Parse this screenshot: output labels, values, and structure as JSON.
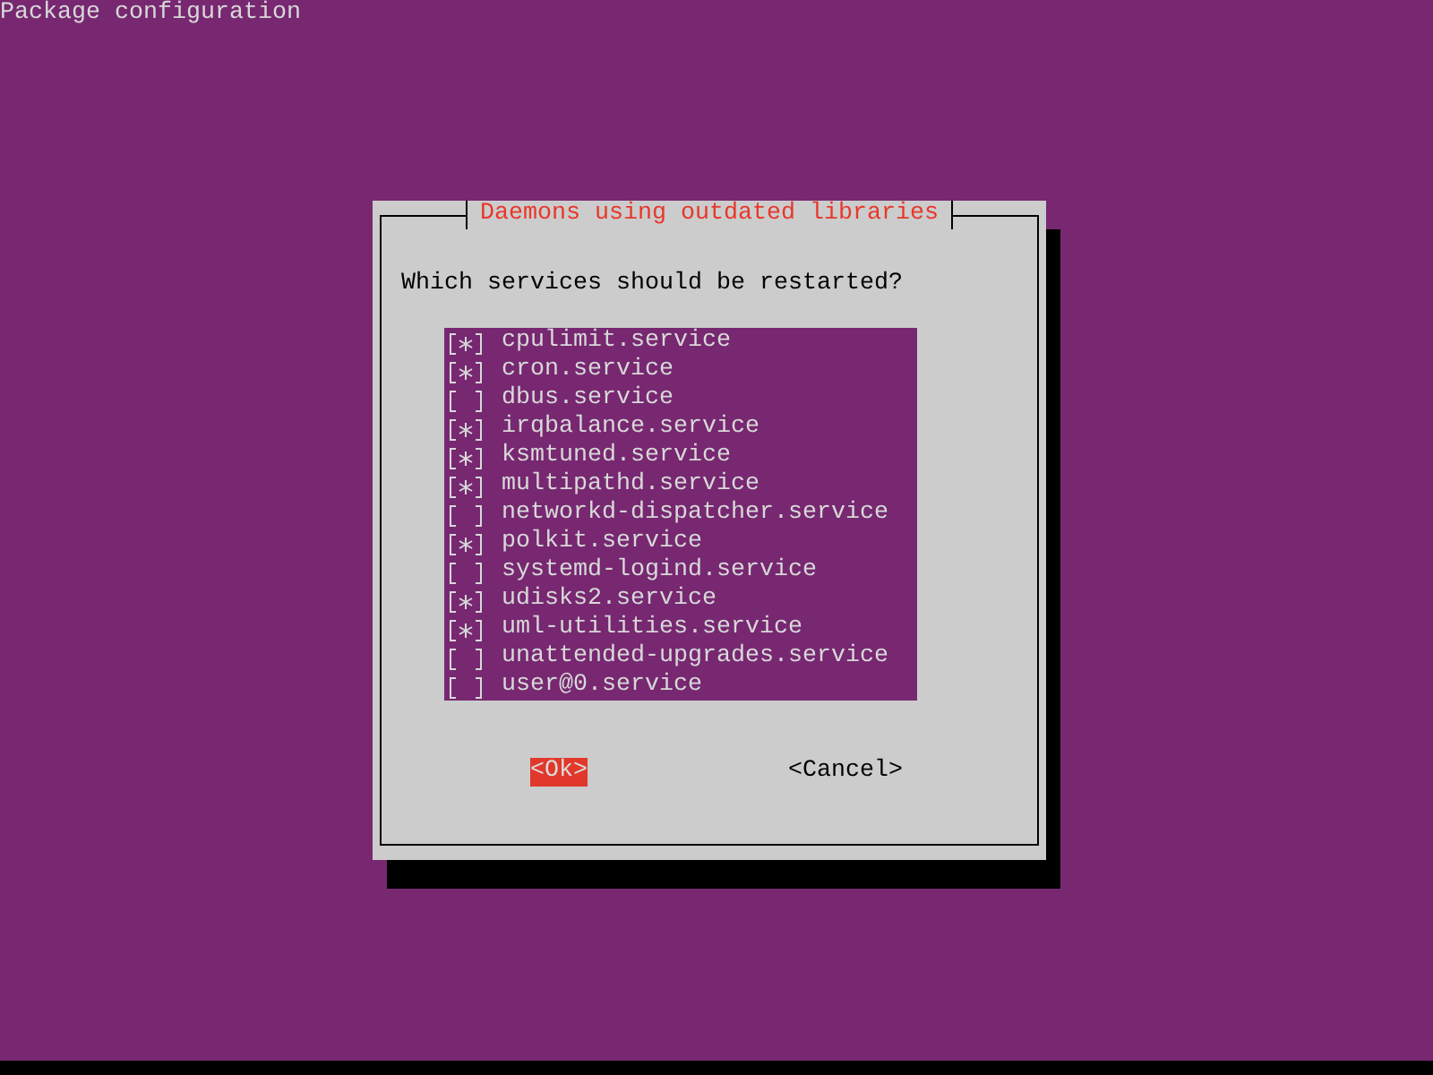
{
  "header": {
    "title": "Package configuration"
  },
  "dialog": {
    "title": "Daemons using outdated libraries",
    "prompt": "Which services should be restarted?",
    "items": [
      {
        "label": "cpulimit.service",
        "checked": true
      },
      {
        "label": "cron.service",
        "checked": true
      },
      {
        "label": "dbus.service",
        "checked": false
      },
      {
        "label": "irqbalance.service",
        "checked": true
      },
      {
        "label": "ksmtuned.service",
        "checked": true
      },
      {
        "label": "multipathd.service",
        "checked": true
      },
      {
        "label": "networkd-dispatcher.service",
        "checked": false
      },
      {
        "label": "polkit.service",
        "checked": true
      },
      {
        "label": "systemd-logind.service",
        "checked": false
      },
      {
        "label": "udisks2.service",
        "checked": true
      },
      {
        "label": "uml-utilities.service",
        "checked": true
      },
      {
        "label": "unattended-upgrades.service",
        "checked": false
      },
      {
        "label": "user@0.service",
        "checked": false
      }
    ],
    "buttons": [
      {
        "label": "<Ok>",
        "selected": true
      },
      {
        "label": "<Cancel>",
        "selected": false
      }
    ]
  }
}
